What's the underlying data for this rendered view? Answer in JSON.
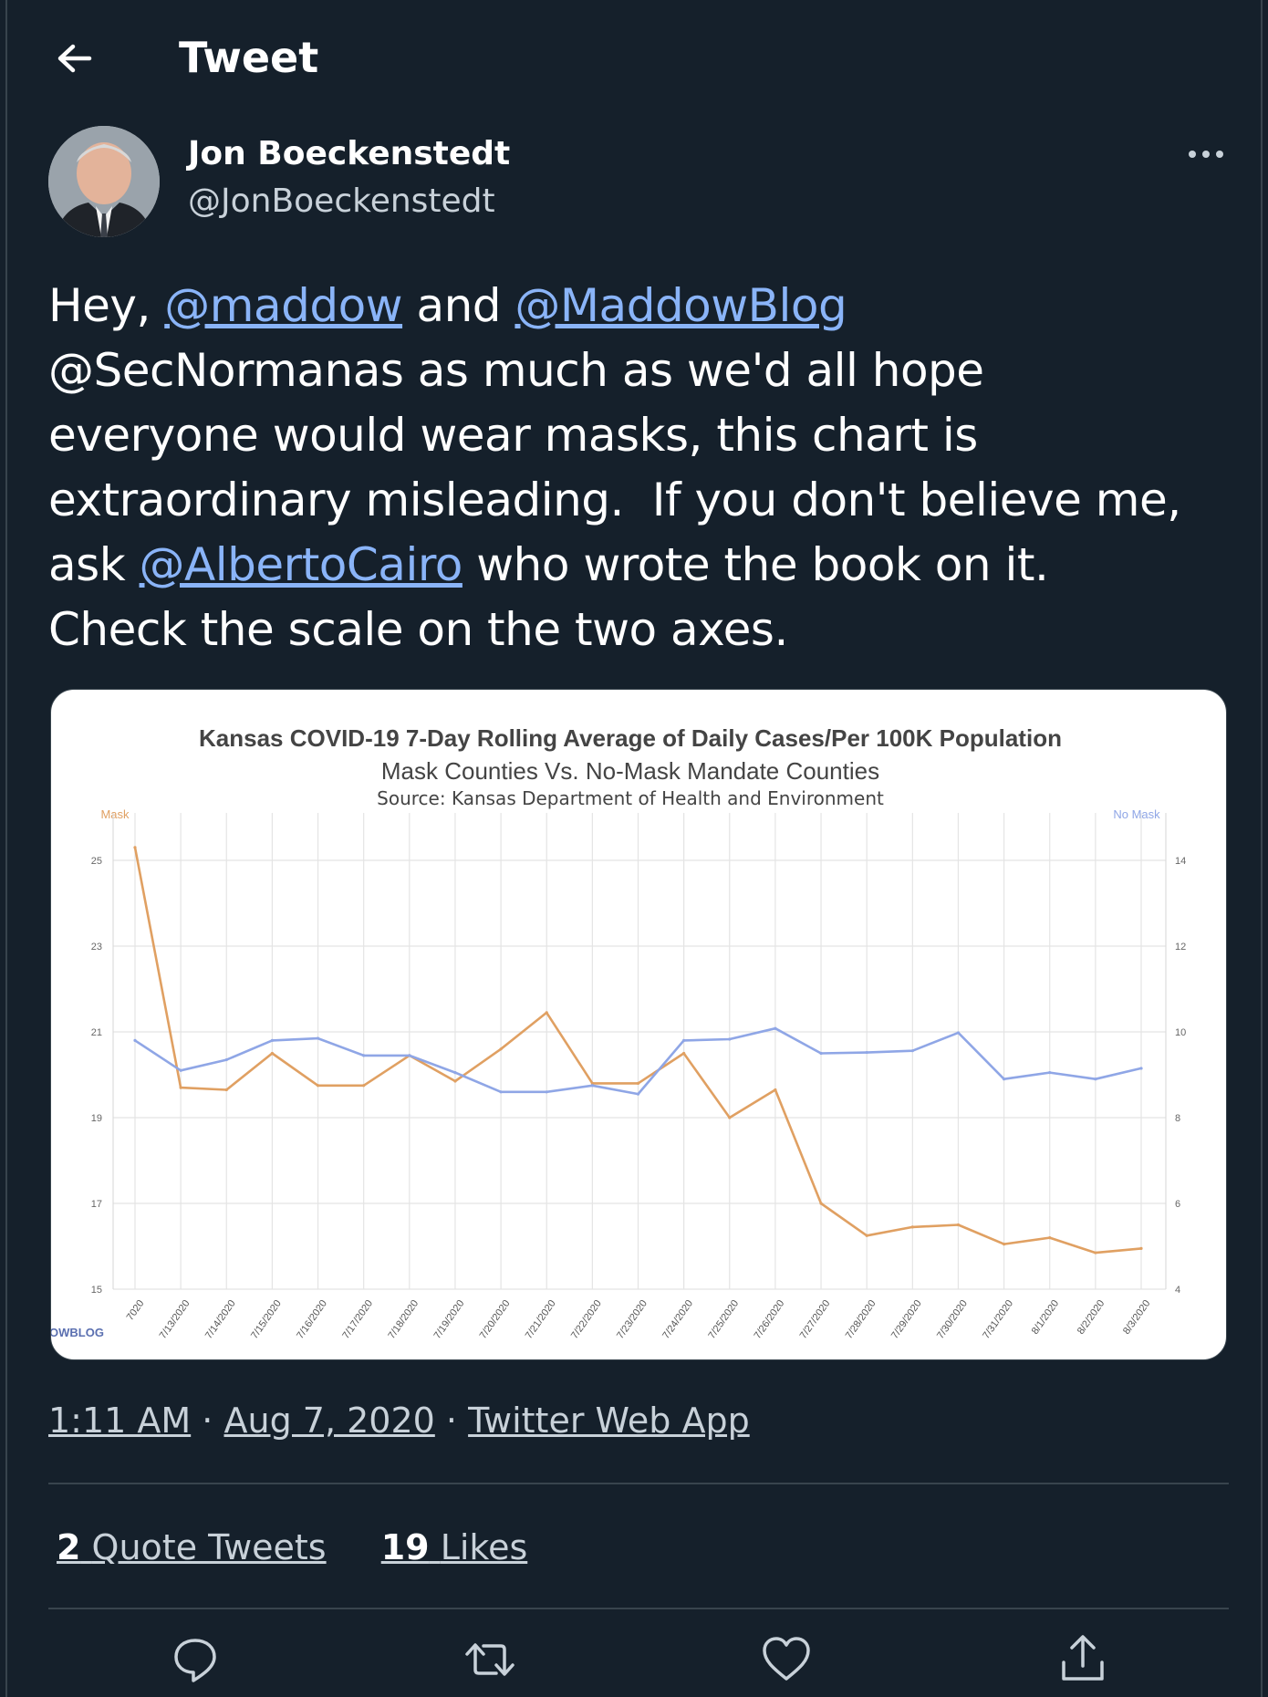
{
  "header": {
    "title": "Tweet"
  },
  "author": {
    "name": "Jon Boeckenstedt",
    "handle": "@JonBoeckenstedt"
  },
  "tweet": {
    "mentions": [
      "@maddow",
      "@MaddowBlog",
      "@AlbertoCairo"
    ],
    "segments": [
      {
        "t": "Hey, ",
        "m": false
      },
      {
        "t": "@maddow",
        "m": true
      },
      {
        "t": " and ",
        "m": false
      },
      {
        "t": "@MaddowBlog",
        "m": true
      },
      {
        "t": "\n@SecNormanas as much as we'd all hope\neveryone would wear masks, this chart is\nextraordinary misleading.  If you don't believe me,\nask ",
        "m": false
      },
      {
        "t": "@AlbertoCairo",
        "m": true
      },
      {
        "t": " who wrote the book on it.\nCheck the scale on the two axes.",
        "m": false
      }
    ]
  },
  "meta": {
    "time": "1:11 AM",
    "date": "Aug 7, 2020",
    "separator": "·",
    "source": "Twitter Web App"
  },
  "stats": {
    "quote_count": "2",
    "quote_label": "Quote Tweets",
    "like_count": "19",
    "like_label": "Likes"
  },
  "colors": {
    "background": "#15202b",
    "mention": "#8ab4f8",
    "mask_series": "#e0a062",
    "no_mask_series": "#8fa6e6"
  },
  "icons": [
    "back-arrow-icon",
    "more-icon",
    "reply-icon",
    "retweet-icon",
    "like-icon",
    "share-icon"
  ],
  "chart_data": {
    "type": "line",
    "title": "Kansas COVID-19 7-Day Rolling Average of Daily Cases/Per 100K Population",
    "subtitle": "Mask Counties Vs. No-Mask Mandate Counties",
    "source": "Source: Kansas Department of Health and Environment",
    "left_axis_label": "Mask",
    "right_axis_label": "No Mask",
    "watermark": "OWBLOG",
    "categories": [
      "7/12/2020",
      "7/13/2020",
      "7/14/2020",
      "7/15/2020",
      "7/16/2020",
      "7/17/2020",
      "7/18/2020",
      "7/19/2020",
      "7/20/2020",
      "7/21/2020",
      "7/22/2020",
      "7/23/2020",
      "7/24/2020",
      "7/25/2020",
      "7/26/2020",
      "7/27/2020",
      "7/28/2020",
      "7/29/2020",
      "7/30/2020",
      "7/31/2020",
      "8/1/2020",
      "8/2/2020",
      "8/3/2020"
    ],
    "category_labels": [
      "7020",
      "7/13/2020",
      "7/14/2020",
      "7/15/2020",
      "7/16/2020",
      "7/17/2020",
      "7/18/2020",
      "7/19/2020",
      "7/20/2020",
      "7/21/2020",
      "7/22/2020",
      "7/23/2020",
      "7/24/2020",
      "7/25/2020",
      "7/26/2020",
      "7/27/2020",
      "7/28/2020",
      "7/29/2020",
      "7/30/2020",
      "7/31/2020",
      "8/1/2020",
      "8/2/2020",
      "8/3/2020"
    ],
    "y_left": {
      "ticks": [
        "25",
        "23",
        "21",
        "19",
        "17",
        "15"
      ],
      "ylim": [
        15,
        25.5
      ]
    },
    "y_right": {
      "ticks": [
        "14",
        "12",
        "10",
        "8",
        "6",
        "4"
      ],
      "ylim": [
        4,
        14
      ]
    },
    "grid": true,
    "series": [
      {
        "name": "Mask",
        "axis": "left",
        "values": [
          25.3,
          19.7,
          19.65,
          20.5,
          19.75,
          19.75,
          20.45,
          19.85,
          20.6,
          21.45,
          19.8,
          19.8,
          20.5,
          19.0,
          19.65,
          17.0,
          16.25,
          16.45,
          16.5,
          16.05,
          16.2,
          15.85,
          15.95
        ]
      },
      {
        "name": "No Mask",
        "axis": "right",
        "values": [
          9.8,
          9.1,
          9.35,
          9.8,
          9.85,
          9.45,
          9.45,
          9.05,
          8.6,
          8.6,
          8.75,
          8.55,
          9.8,
          9.83,
          10.08,
          9.5,
          9.52,
          9.56,
          9.98,
          8.9,
          9.05,
          8.9,
          9.15
        ]
      }
    ]
  }
}
